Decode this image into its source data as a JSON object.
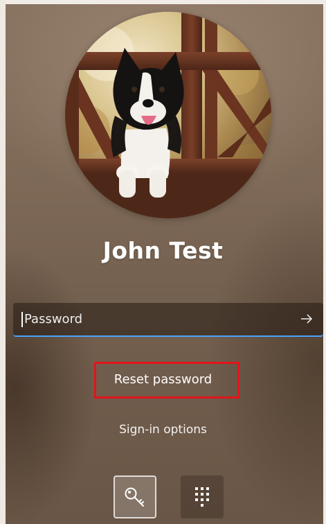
{
  "user": {
    "name": "John Test",
    "avatar_alt": "dog-photo"
  },
  "password_field": {
    "placeholder": "Password",
    "value": ""
  },
  "links": {
    "reset_password": "Reset password",
    "sign_in_options": "Sign-in options"
  },
  "sign_in_options": [
    {
      "icon": "key-icon",
      "selected": true
    },
    {
      "icon": "pin-keypad-icon",
      "selected": false
    }
  ],
  "colors": {
    "field_underline": "#4aa3ff",
    "highlight_box": "#e3131b",
    "text": "#ffffff"
  }
}
